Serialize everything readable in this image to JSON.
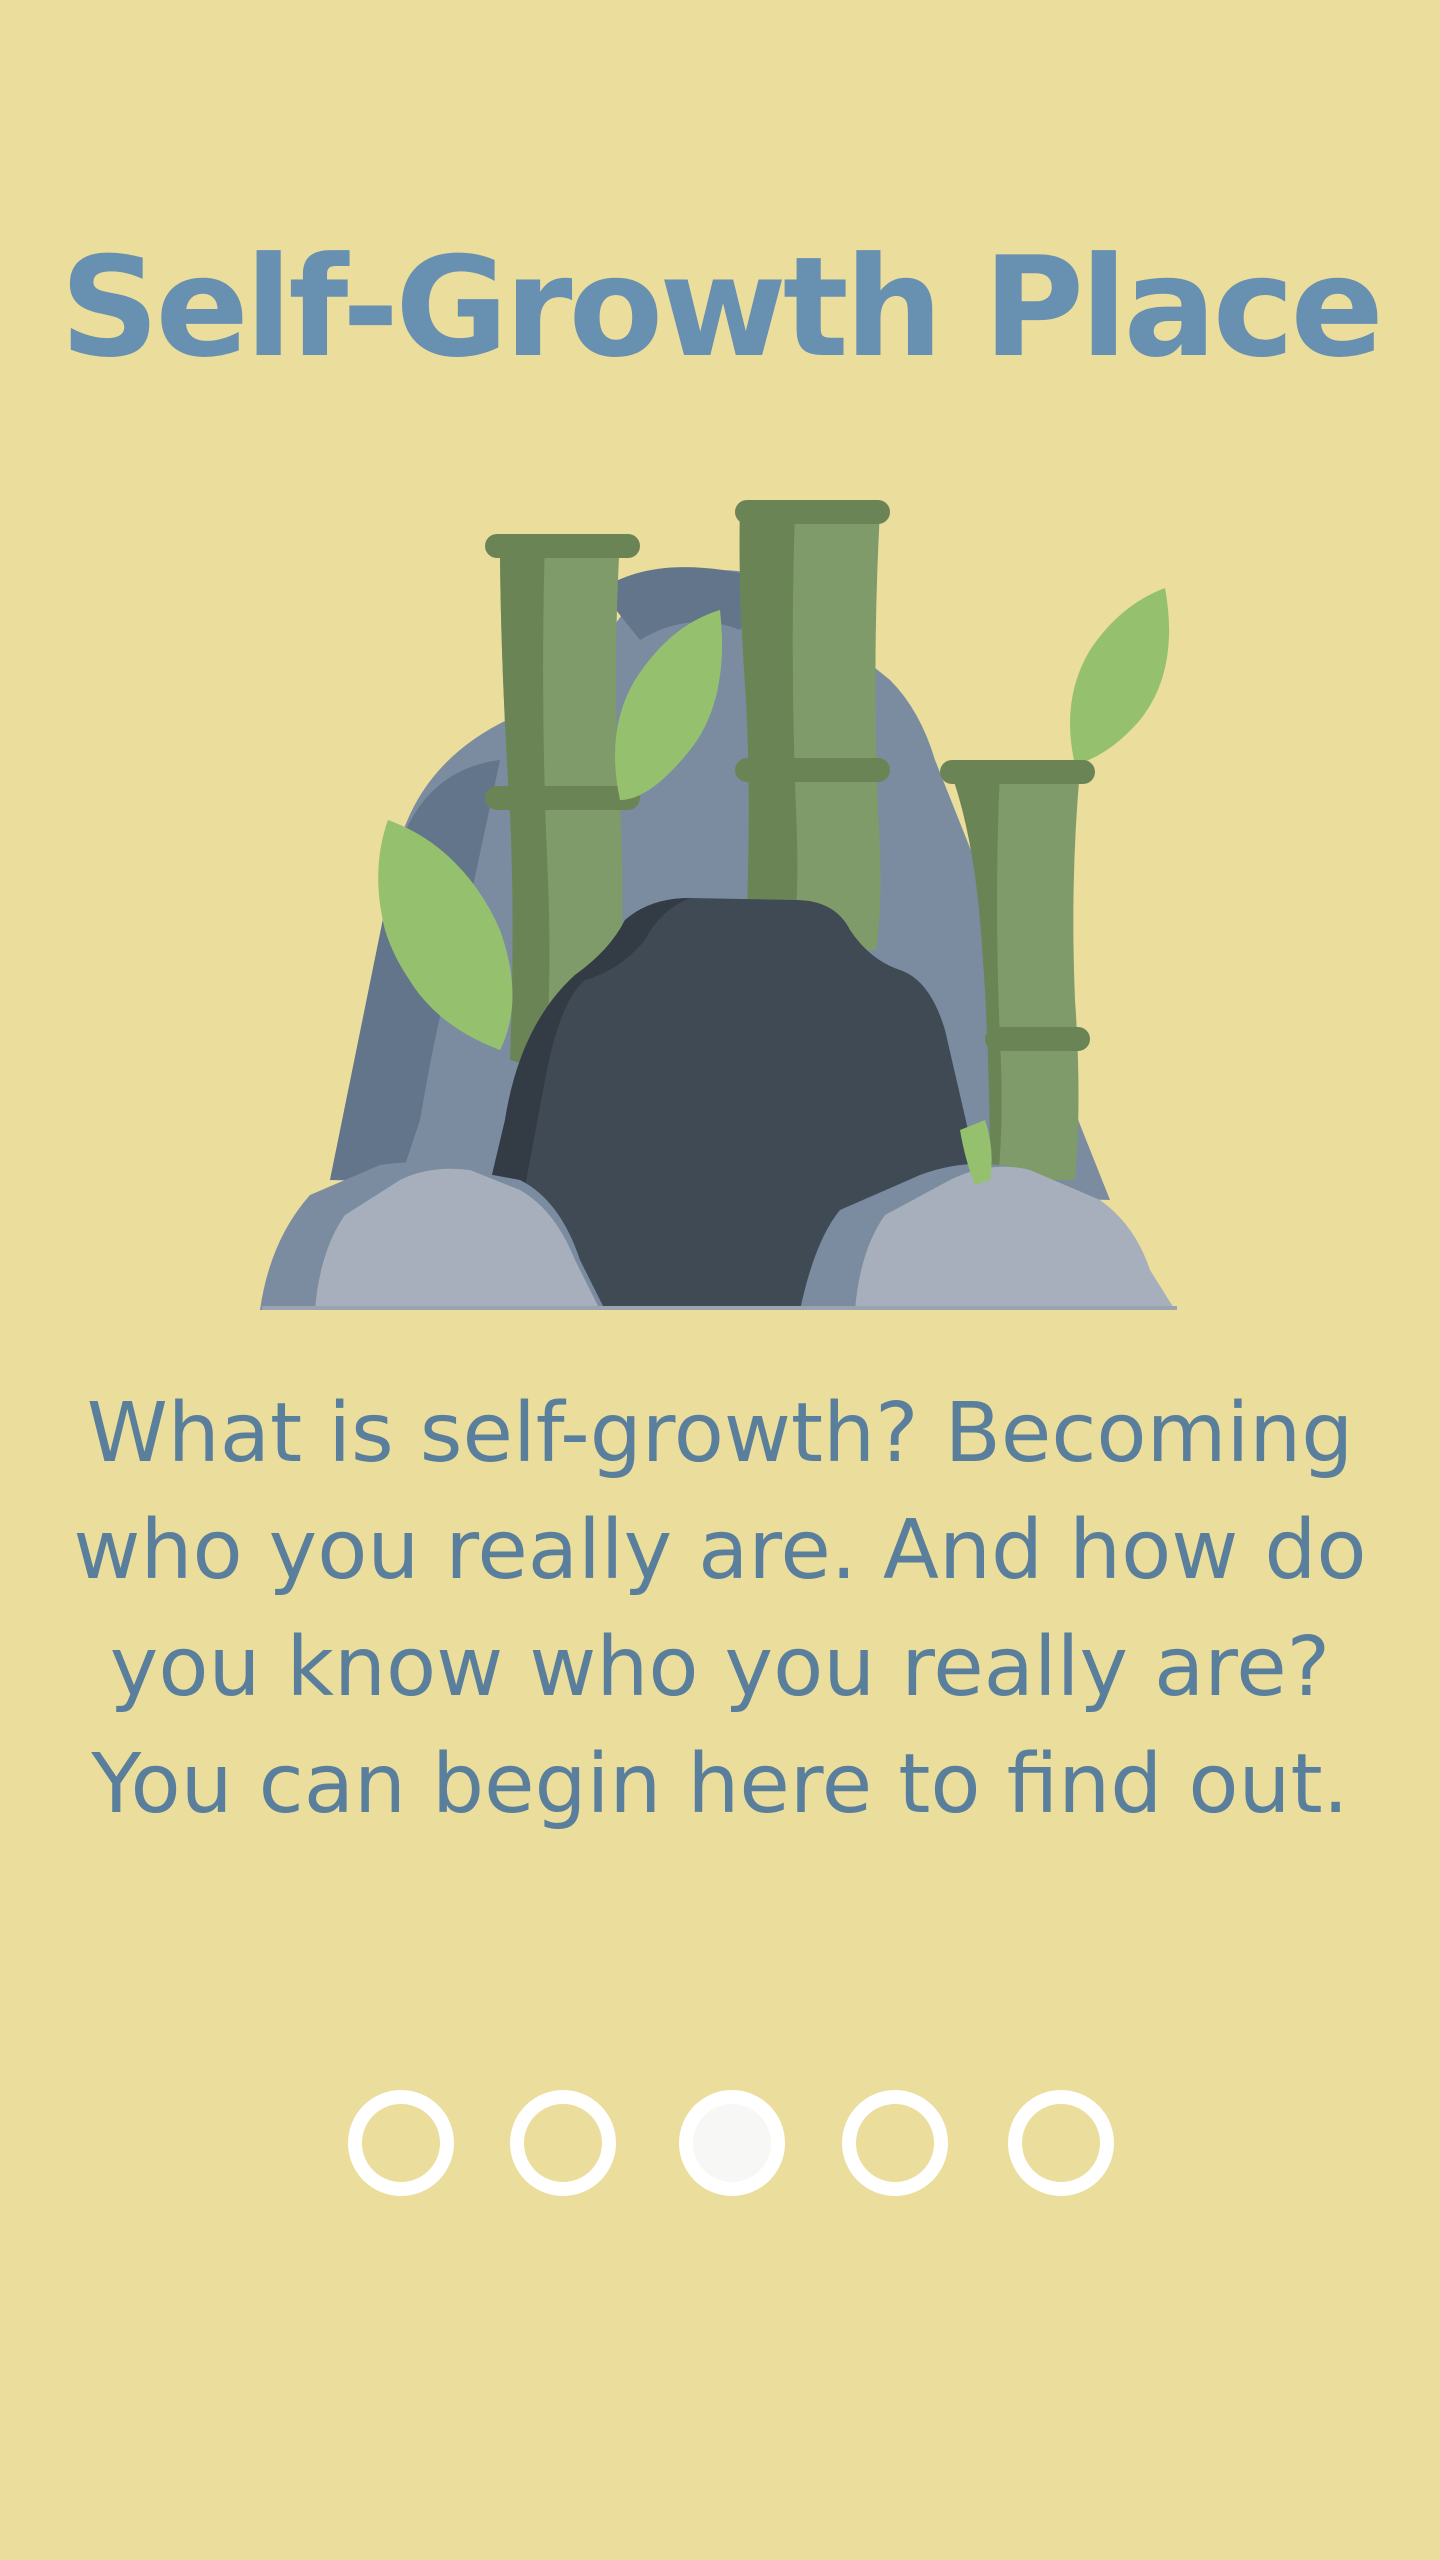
{
  "title": "Self-Growth Place",
  "description": "What is self-growth? Becoming who you really are. And how do you know who you really are? You can begin here to find out.",
  "illustration": {
    "icon": "bamboo-cave-illustration"
  },
  "pager": {
    "total": 5,
    "active_index": 2
  },
  "colors": {
    "background": "#ebdd9b",
    "title": "#6790b1",
    "text": "#5a7f9c",
    "indicator": "#ffffff"
  }
}
